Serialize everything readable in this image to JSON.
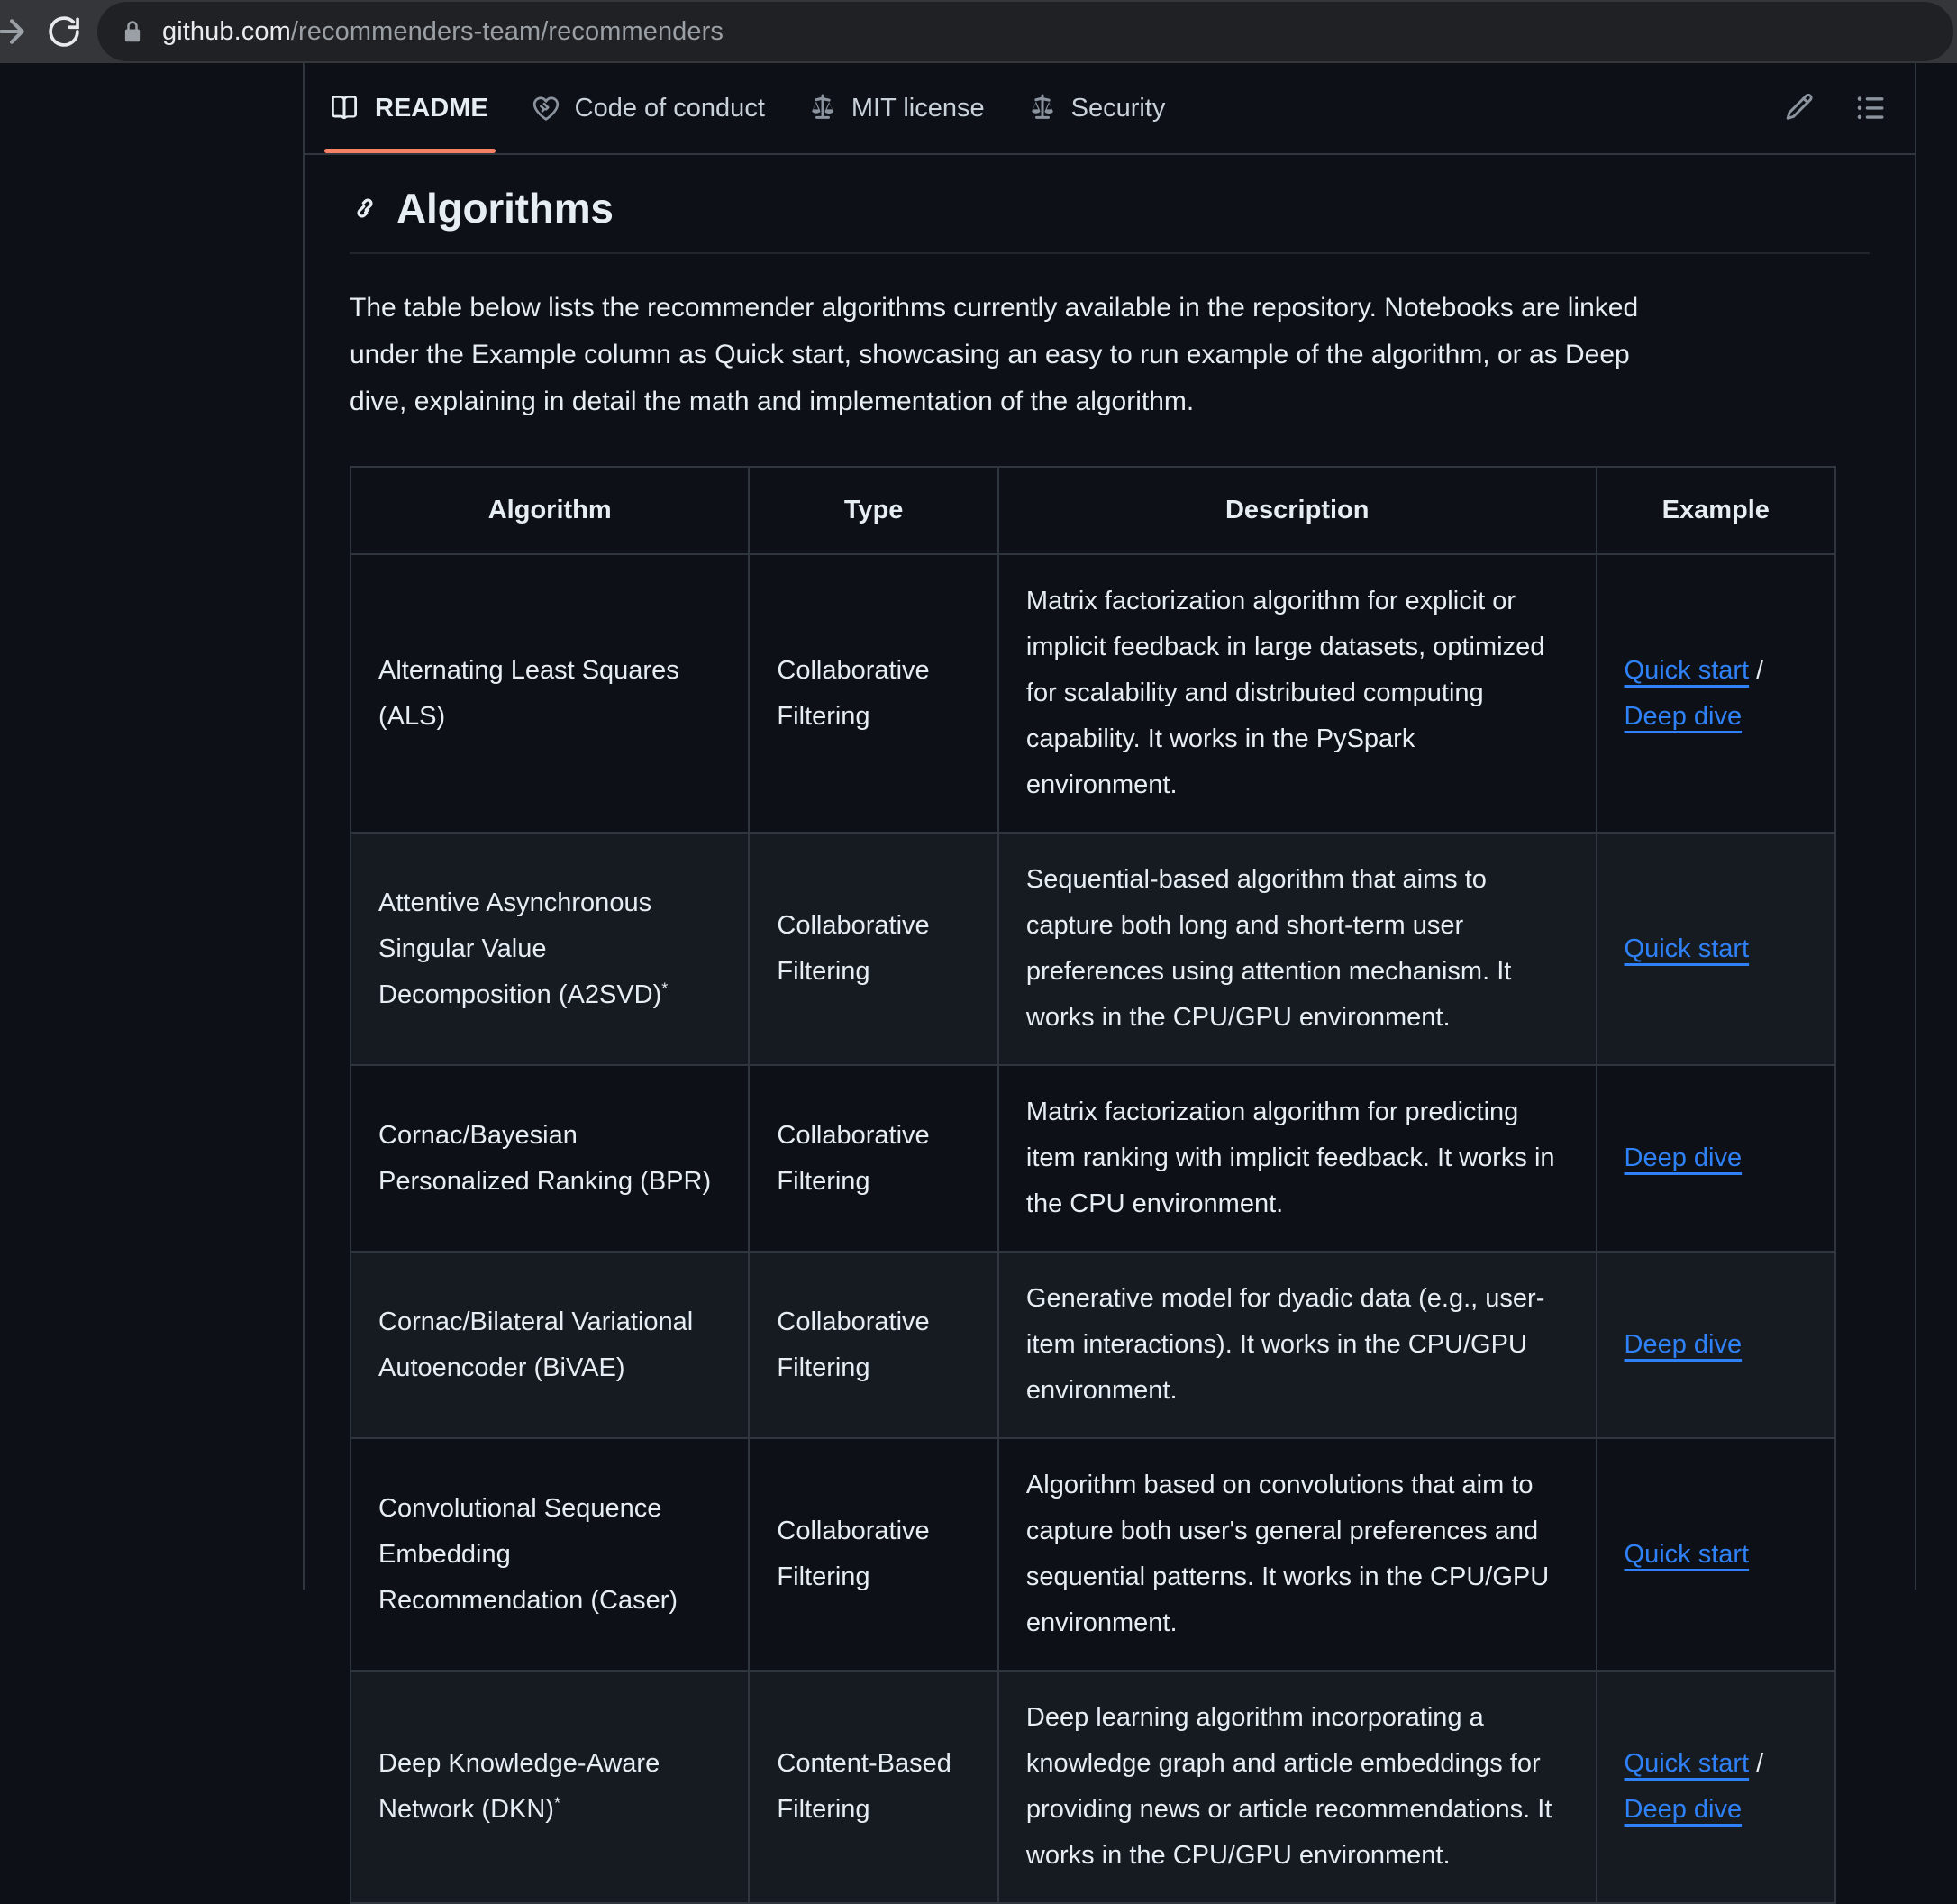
{
  "browser": {
    "forward_icon": "forward-arrow-icon",
    "reload_icon": "reload-icon",
    "lock_icon": "lock-icon",
    "url_host": "github.com",
    "url_path": "/recommenders-team/recommenders"
  },
  "repo_nav": {
    "tabs": [
      {
        "label": "README",
        "icon": "book-icon",
        "active": true
      },
      {
        "label": "Code of conduct",
        "icon": "heart-handshake-icon",
        "active": false
      },
      {
        "label": "MIT license",
        "icon": "law-scale-icon",
        "active": false
      },
      {
        "label": "Security",
        "icon": "law-scale-icon",
        "active": false
      }
    ],
    "actions": [
      {
        "name": "edit-readme-button",
        "icon": "pencil-icon"
      },
      {
        "name": "outline-button",
        "icon": "list-unordered-icon"
      }
    ],
    "active_underline_color": "#f78166"
  },
  "readme": {
    "heading": "Algorithms",
    "heading_anchor_icon": "link-icon",
    "intro": "The table below lists the recommender algorithms currently available in the repository. Notebooks are linked under the Example column as Quick start, showcasing an easy to run example of the algorithm, or as Deep dive, explaining in detail the math and implementation of the algorithm.",
    "table": {
      "headers": [
        "Algorithm",
        "Type",
        "Description",
        "Example"
      ],
      "rows": [
        {
          "algorithm": "Alternating Least Squares (ALS)",
          "starred": false,
          "type": "Collaborative Filtering",
          "description": "Matrix factorization algorithm for explicit or implicit feedback in large datasets, optimized for scalability and distributed computing capability. It works in the PySpark environment.",
          "examples": [
            "Quick start",
            "Deep dive"
          ]
        },
        {
          "algorithm": "Attentive Asynchronous Singular Value Decomposition (A2SVD)",
          "starred": true,
          "type": "Collaborative Filtering",
          "description": "Sequential-based algorithm that aims to capture both long and short-term user preferences using attention mechanism. It works in the CPU/GPU environment.",
          "examples": [
            "Quick start"
          ]
        },
        {
          "algorithm": "Cornac/Bayesian Personalized Ranking (BPR)",
          "starred": false,
          "type": "Collaborative Filtering",
          "description": "Matrix factorization algorithm for predicting item ranking with implicit feedback. It works in the CPU environment.",
          "examples": [
            "Deep dive"
          ]
        },
        {
          "algorithm": "Cornac/Bilateral Variational Autoencoder (BiVAE)",
          "starred": false,
          "type": "Collaborative Filtering",
          "description": "Generative model for dyadic data (e.g., user-item interactions). It works in the CPU/GPU environment.",
          "examples": [
            "Deep dive"
          ]
        },
        {
          "algorithm": "Convolutional Sequence Embedding Recommendation (Caser)",
          "starred": false,
          "type": "Collaborative Filtering",
          "description": "Algorithm based on convolutions that aim to capture both user's general preferences and sequential patterns. It works in the CPU/GPU environment.",
          "examples": [
            "Quick start"
          ]
        },
        {
          "algorithm": "Deep Knowledge-Aware Network (DKN)",
          "starred": true,
          "type": "Content-Based Filtering",
          "description": "Deep learning algorithm incorporating a knowledge graph and article embeddings for providing news or article recommendations. It works in the CPU/GPU environment.",
          "examples": [
            "Quick start",
            "Deep dive"
          ]
        }
      ]
    }
  },
  "colors": {
    "page_background": "#0d1117",
    "row_alt_background": "#161b22",
    "border": "#30363d",
    "link": "#2f81f7",
    "text": "#e6edf3",
    "muted_text": "#8b949e",
    "browser_chrome": "#35363a",
    "omnibox": "#202124"
  }
}
